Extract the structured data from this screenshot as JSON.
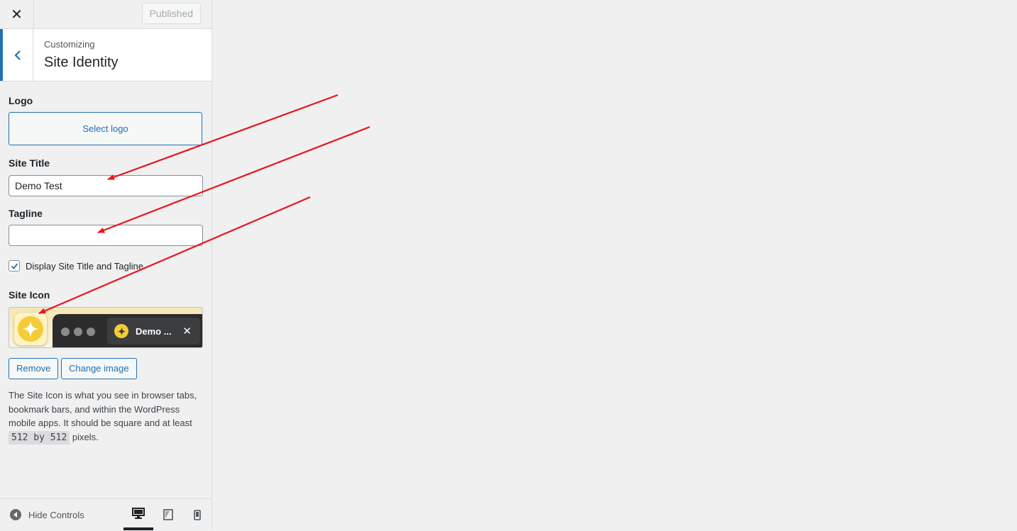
{
  "header": {
    "close_icon": "close-icon",
    "published_label": "Published"
  },
  "section": {
    "back_icon": "chevron-left-icon",
    "breadcrumb": "Customizing",
    "title": "Site Identity"
  },
  "logo": {
    "label": "Logo",
    "button_label": "Select logo"
  },
  "site_title": {
    "label": "Site Title",
    "value": "Demo Test"
  },
  "tagline": {
    "label": "Tagline",
    "value": ""
  },
  "display_title_tagline": {
    "label": "Display Site Title and Tagline",
    "checked": true
  },
  "site_icon": {
    "label": "Site Icon",
    "tab_title": "Demo ...",
    "remove_label": "Remove",
    "change_label": "Change image",
    "description_part1": "The Site Icon is what you see in browser tabs, bookmark bars, and within the WordPress mobile apps. It should be square and at least ",
    "description_code": "512 by 512",
    "description_part2": " pixels."
  },
  "footer": {
    "hide_controls_label": "Hide Controls",
    "devices": [
      "desktop-icon",
      "tablet-icon",
      "mobile-icon"
    ],
    "active_device": "desktop"
  },
  "colors": {
    "accent": "#2271b1",
    "annotation_arrow": "#e8141e",
    "icon_yellow": "#f4cc35"
  }
}
